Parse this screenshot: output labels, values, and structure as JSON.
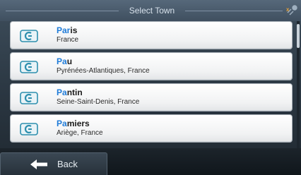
{
  "header": {
    "title": "Select Town",
    "status_icon": "gps-satellite-icon"
  },
  "results": [
    {
      "match": "Par",
      "rest": "is",
      "subtitle": "France",
      "icon": "town-icon"
    },
    {
      "match": "Pa",
      "rest": "u",
      "subtitle": "Pyrénées-Atlantiques, France",
      "icon": "town-icon"
    },
    {
      "match": "Pa",
      "rest": "ntin",
      "subtitle": "Seine-Saint-Denis, France",
      "icon": "town-icon"
    },
    {
      "match": "Pa",
      "rest": "miers",
      "subtitle": "Ariège, France",
      "icon": "town-icon"
    }
  ],
  "footer": {
    "back_label": "Back",
    "back_icon": "back-arrow-icon"
  },
  "colors": {
    "match_highlight": "#1e7bd8",
    "icon_teal": "#2e8fae"
  }
}
